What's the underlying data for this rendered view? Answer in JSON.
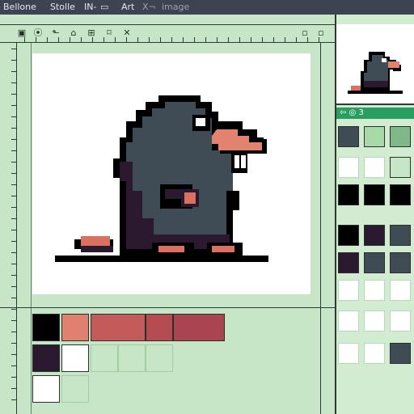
{
  "menu": {
    "items": [
      "Bellone",
      "Stolle",
      "IN-",
      "Art",
      "X̶̶",
      "Image"
    ],
    "app_name": "Bellone",
    "menu_2": "Stolle",
    "menu_3": "IN-",
    "menu_4": "Art",
    "menu_5": "X¬",
    "menu_6": "image"
  },
  "toolbar": {
    "tools": [
      "select-tool",
      "camera-tool",
      "folder-tool",
      "lock-tool",
      "frame-tool",
      "crop-tool",
      "close-tool"
    ],
    "glyphs": {
      "select": "▣",
      "capture": "⦿",
      "folder": "⬑",
      "lock": "⌂",
      "frame": "⊞",
      "crop": "⌑",
      "close": "✕",
      "right_a": "▫",
      "right_b": "▫"
    }
  },
  "layers_tab": {
    "label": "⇦ ◎ 3"
  },
  "colors": {
    "ui_dark": "#3b4450",
    "canvas_bg": "#c7e6c7",
    "artboard": "#ffffff",
    "accent_tab": "#2a9e61",
    "mole_body": "#3f4b55",
    "mole_shadow": "#2b1930",
    "mole_nose": "#e2836f",
    "mole_feet": "#d97060",
    "outline": "#000000"
  },
  "swatches_bottom": [
    {
      "color": "#000000"
    },
    {
      "color": "#e0806f"
    },
    {
      "color": "#c45a5a"
    },
    {
      "color": "#b44c51"
    },
    {
      "color": "#a94550"
    },
    {
      "color": "#2b1930"
    },
    {
      "color": "#ffffff"
    },
    {
      "color": "#c7e6c7"
    },
    {
      "color": "#c7e6c7"
    },
    {
      "color": "#c7e6c7"
    },
    {
      "color": "#ffffff"
    },
    {
      "color": "#c7e6c7"
    }
  ],
  "swatches_panel": [
    {
      "color": "#3f4b55"
    },
    {
      "color": "#a8d9a8"
    },
    {
      "color": "#7fb98a"
    },
    {
      "color": "#ffffff"
    },
    {
      "color": "#ffffff"
    },
    {
      "color": "#c7e6c7"
    },
    {
      "color": "#000000"
    },
    {
      "color": "#000000"
    },
    {
      "color": "#000000"
    },
    {
      "color": "#000000"
    },
    {
      "color": "#2b1930"
    },
    {
      "color": "#3f4b55"
    },
    {
      "color": "#2b1930"
    },
    {
      "color": "#3f4b55"
    },
    {
      "color": "#3f4b55"
    },
    {
      "color": "#ffffff"
    },
    {
      "color": "#ffffff"
    },
    {
      "color": "#ffffff"
    },
    {
      "color": "#ffffff"
    },
    {
      "color": "#ffffff"
    },
    {
      "color": "#ffffff"
    },
    {
      "color": "#ffffff"
    },
    {
      "color": "#ffffff"
    },
    {
      "color": "#3f4b55"
    }
  ]
}
